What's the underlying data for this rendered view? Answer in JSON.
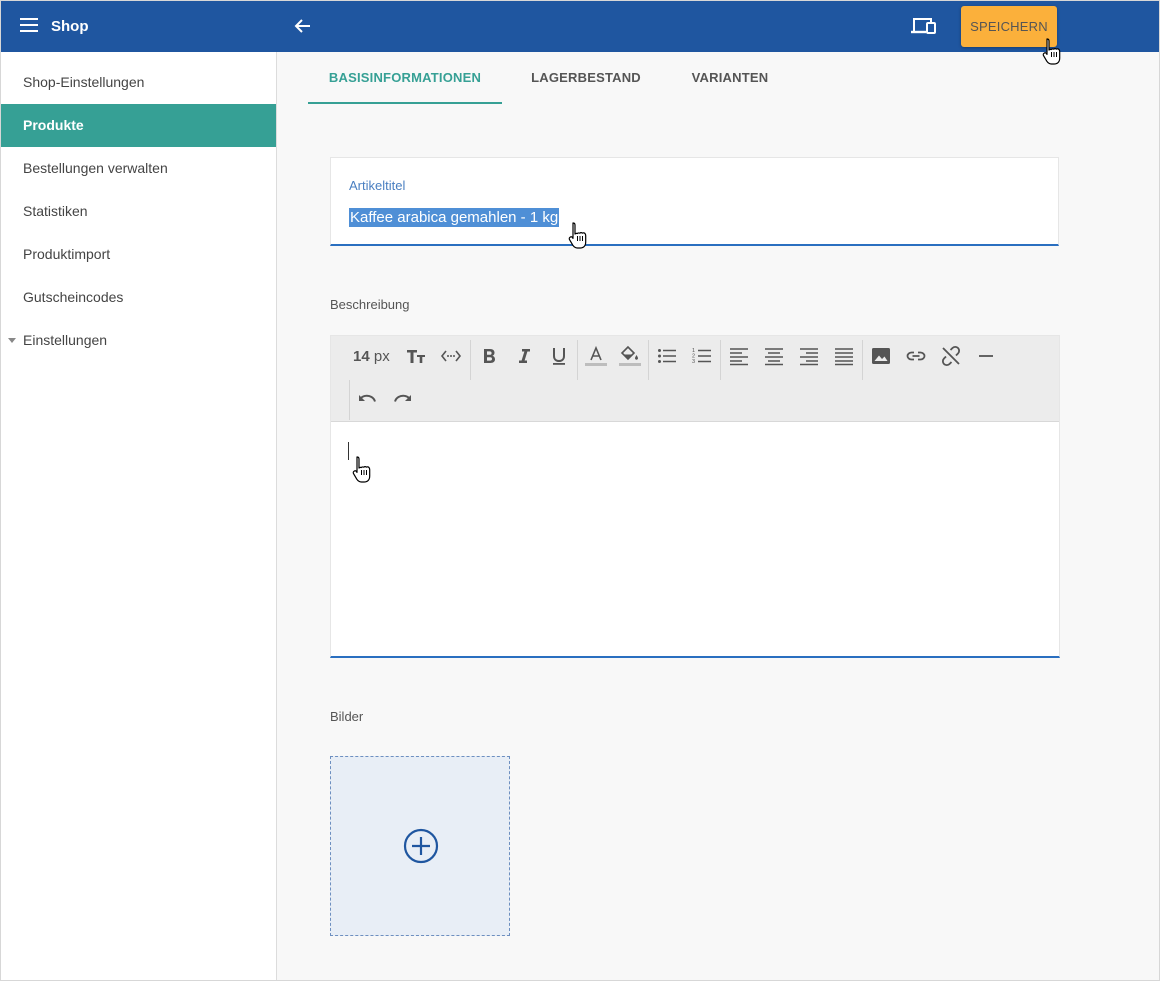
{
  "header": {
    "app_title": "Shop",
    "menu_icon": "menu-icon",
    "back_icon": "arrow-left-icon",
    "devices_icon": "devices-icon",
    "save_label": "SPEICHERN",
    "colors": {
      "bar": "#1f56a0",
      "save_button": "#fbb03b"
    }
  },
  "sidebar": {
    "items": [
      {
        "label": "Shop-Einstellungen"
      },
      {
        "label": "Produkte",
        "active": true
      },
      {
        "label": "Bestellungen verwalten"
      },
      {
        "label": "Statistiken"
      },
      {
        "label": "Produktimport"
      },
      {
        "label": "Gutscheincodes"
      },
      {
        "label": "Einstellungen",
        "expandable": true
      }
    ],
    "active_color": "#36a095"
  },
  "tabs": [
    {
      "label": "BASISINFORMATIONEN",
      "active": true
    },
    {
      "label": "LAGERBESTAND"
    },
    {
      "label": "VARIANTEN"
    }
  ],
  "form": {
    "title_label": "Artikeltitel",
    "title_value": "Kaffee arabica gemahlen - 1 kg",
    "description_label": "Beschreibung",
    "description_value": "",
    "font_size_value": "14",
    "font_size_unit": "px",
    "toolbar_icons": [
      "font-size-icon",
      "code-view-icon",
      "bold-icon",
      "italic-icon",
      "underline-icon",
      "text-color-icon",
      "fill-color-icon",
      "bulleted-list-icon",
      "numbered-list-icon",
      "align-left-icon",
      "align-center-icon",
      "align-right-icon",
      "align-justify-icon",
      "insert-image-icon",
      "insert-link-icon",
      "remove-link-icon",
      "horizontal-rule-icon",
      "undo-icon",
      "redo-icon"
    ],
    "images_label": "Bilder",
    "add_image_icon": "add-circle-icon"
  }
}
